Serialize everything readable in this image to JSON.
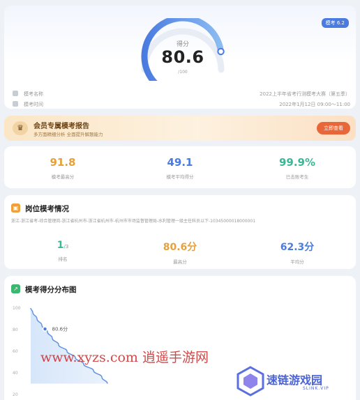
{
  "score_card": {
    "badge": "模考 6.2",
    "score_label": "得分",
    "score": "80.6",
    "score_sub": "/100",
    "score_fraction": 0.806,
    "exam_label": "模考名称",
    "exam_value": "2022上半年省考行测模考大赛（第五季）",
    "time_label": "模考时间",
    "time_value": "2022年1月12日 09:00～11:00"
  },
  "member": {
    "title": "会员专属模考报告",
    "subtitle": "多方面精细分析 全面提升解题能力",
    "button": "立即查看"
  },
  "stats": [
    {
      "value": "91.8",
      "label": "模考最高分",
      "color": "#e6a13a"
    },
    {
      "value": "49.1",
      "label": "模考平均得分",
      "color": "#4a7be0"
    },
    {
      "value": "99.9%",
      "label": "已击败考生",
      "color": "#3ab896"
    }
  ],
  "post": {
    "title": "岗位模考情况",
    "path": "浙江-浙江省考-综合管理岗-浙江省杭州市-浙江省杭州市-杭州市市场监督管理局-水利管理一级主任科员以下-10345000018000001",
    "stats": [
      {
        "value": "1",
        "unit": "/3",
        "label": "排名",
        "color": "#3ab896"
      },
      {
        "value": "80.6分",
        "unit": "",
        "label": "最高分",
        "color": "#e6a13a"
      },
      {
        "value": "62.3分",
        "unit": "",
        "label": "平均分",
        "color": "#4a7be0"
      }
    ]
  },
  "distribution": {
    "title": "模考得分分布图",
    "marker_label": "80.6分"
  },
  "chart_data": {
    "type": "area",
    "title": "模考得分分布图",
    "yticks": [
      "100",
      "80",
      "60",
      "40",
      "20"
    ],
    "y": [
      100,
      96,
      90,
      84,
      78,
      72,
      66,
      60,
      54,
      48,
      42,
      36,
      30
    ],
    "x": [
      0,
      3,
      9,
      16,
      24,
      31,
      40,
      52,
      64,
      76,
      90,
      102,
      110
    ],
    "highlight": {
      "y": 80.6,
      "label": "80.6分"
    },
    "ylim": [
      20,
      100
    ]
  },
  "watermark": {
    "text": "www.xyzs.com 逍遥手游网",
    "logo_title": "速链游戏园",
    "logo_sub": "SLINK.VIP"
  },
  "colors": {
    "accent": "#4a7be0",
    "gauge_end": "#7fb0ee",
    "orange": "#e8673a",
    "green": "#3ab896"
  }
}
